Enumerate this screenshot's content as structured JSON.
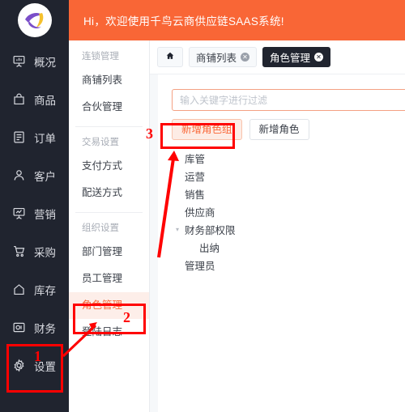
{
  "banner": {
    "text": "Hi，欢迎使用千鸟云商供应链SAAS系统!",
    "color": "#f96636"
  },
  "logo": {
    "name": "qianniao-logo",
    "shape_colors": [
      "#7b4fc9",
      "#f5c12e"
    ]
  },
  "rail": {
    "background": "#20242f",
    "items": [
      {
        "icon": "dashboard-icon",
        "label": "概况"
      },
      {
        "icon": "bag-icon",
        "label": "商品"
      },
      {
        "icon": "list-doc-icon",
        "label": "订单"
      },
      {
        "icon": "user-icon",
        "label": "客户"
      },
      {
        "icon": "marketing-chart-icon",
        "label": "营销"
      },
      {
        "icon": "cart-icon",
        "label": "采购"
      },
      {
        "icon": "home-icon",
        "label": "库存"
      },
      {
        "icon": "finance-icon",
        "label": "财务"
      },
      {
        "icon": "gear-icon",
        "label": "设置"
      }
    ]
  },
  "submenu": {
    "groups": [
      {
        "title": "连锁管理",
        "items": [
          {
            "label": "商铺列表",
            "active": false
          },
          {
            "label": "合伙管理",
            "active": false
          }
        ]
      },
      {
        "title": "交易设置",
        "items": [
          {
            "label": "支付方式",
            "active": false
          },
          {
            "label": "配送方式",
            "active": false
          }
        ]
      },
      {
        "title": "组织设置",
        "items": [
          {
            "label": "部门管理",
            "active": false
          },
          {
            "label": "员工管理",
            "active": false
          },
          {
            "label": "角色管理",
            "active": true
          },
          {
            "label": "登陆日志",
            "active": false
          }
        ]
      }
    ]
  },
  "tabs": {
    "home_icon": "home-icon",
    "items": [
      {
        "label": "商铺列表",
        "active": false,
        "closable": true
      },
      {
        "label": "角色管理",
        "active": true,
        "closable": true
      }
    ],
    "close_glyph": "✕"
  },
  "panel": {
    "filter": {
      "placeholder": "输入关键字进行过滤",
      "value": "",
      "border_color": "#f4a183"
    },
    "buttons": [
      {
        "label": "新增角色组",
        "style": "primary-ghost"
      },
      {
        "label": "新增角色",
        "style": "default"
      }
    ],
    "tree": [
      {
        "label": "库管",
        "level": 0,
        "caret": false
      },
      {
        "label": "运营",
        "level": 0,
        "caret": false
      },
      {
        "label": "销售",
        "level": 0,
        "caret": false
      },
      {
        "label": "供应商",
        "level": 0,
        "caret": false
      },
      {
        "label": "财务部权限",
        "level": 0,
        "caret": true,
        "expanded": true
      },
      {
        "label": "出纳",
        "level": 1,
        "caret": false
      },
      {
        "label": "管理员",
        "level": 0,
        "caret": false
      }
    ],
    "caret_glyph": "▾"
  },
  "annotations": {
    "color": "#ff0000",
    "markers": [
      {
        "number": "1",
        "target": "sidebar-item-settings"
      },
      {
        "number": "2",
        "target": "submenu-item-role-management"
      },
      {
        "number": "3",
        "target": "add-role-group-button"
      }
    ]
  }
}
